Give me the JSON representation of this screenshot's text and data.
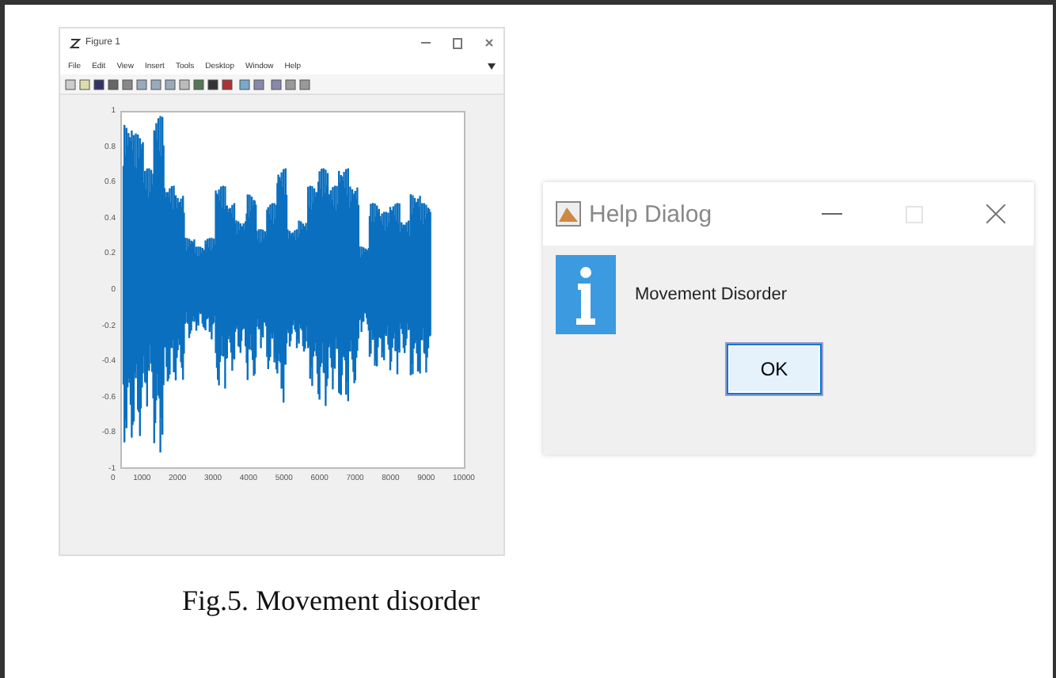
{
  "figure_window": {
    "title": "Figure 1",
    "menu": [
      "File",
      "Edit",
      "View",
      "Insert",
      "Tools",
      "Desktop",
      "Window",
      "Help"
    ],
    "axes": {
      "y_ticks": [
        "1",
        "0.8",
        "0.6",
        "0.4",
        "0.2",
        "0",
        "-0.2",
        "-0.4",
        "-0.6",
        "-0.8",
        "-1"
      ],
      "x_ticks": [
        "0",
        "1000",
        "2000",
        "3000",
        "4000",
        "5000",
        "6000",
        "7000",
        "8000",
        "9000",
        "10000"
      ]
    }
  },
  "help_dialog": {
    "title": "Help Dialog",
    "message": "Movement Disorder",
    "button": "OK"
  },
  "caption": "Fig.5. Movement disorder"
}
